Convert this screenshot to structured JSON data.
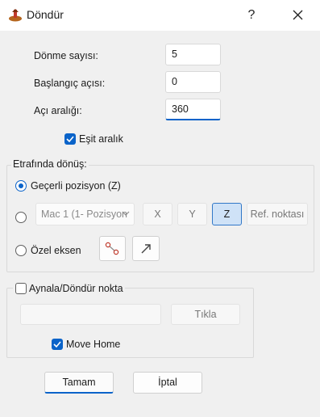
{
  "window": {
    "title": "Döndür",
    "help_label": "?",
    "close_icon": "close-icon",
    "app_icon": "app-icon"
  },
  "fields": {
    "count_label": "Dönme sayısı:",
    "count_value": "5",
    "start_angle_label": "Başlangıç açısı:",
    "start_angle_value": "0",
    "angle_range_label": "Açı aralığı:",
    "angle_range_value": "360"
  },
  "equal_spacing": {
    "label": "Eşit aralık",
    "checked": true
  },
  "rotate_around": {
    "title": "Etrafında dönüş:",
    "current_position_label": "Geçerli pozisyon (Z)",
    "current_position_selected": true,
    "machine_combo_value": "Mac 1 (1- Pozisyon",
    "x_label": "X",
    "y_label": "Y",
    "z_label": "Z",
    "z_pressed": true,
    "ref_point_label": "Ref. noktası",
    "custom_axis_label": "Özel eksen",
    "axis_pick_icon": "line-segment-icon",
    "axis_arrow_icon": "arrow-icon"
  },
  "mirror": {
    "label": "Aynala/Döndür nokta",
    "checked": false,
    "click_label": "Tıkla",
    "move_home_label": "Move Home",
    "move_home_checked": true
  },
  "actions": {
    "ok_label": "Tamam",
    "cancel_label": "İptal"
  },
  "colors": {
    "accent": "#0a63c9",
    "background": "#f0f0f0"
  }
}
